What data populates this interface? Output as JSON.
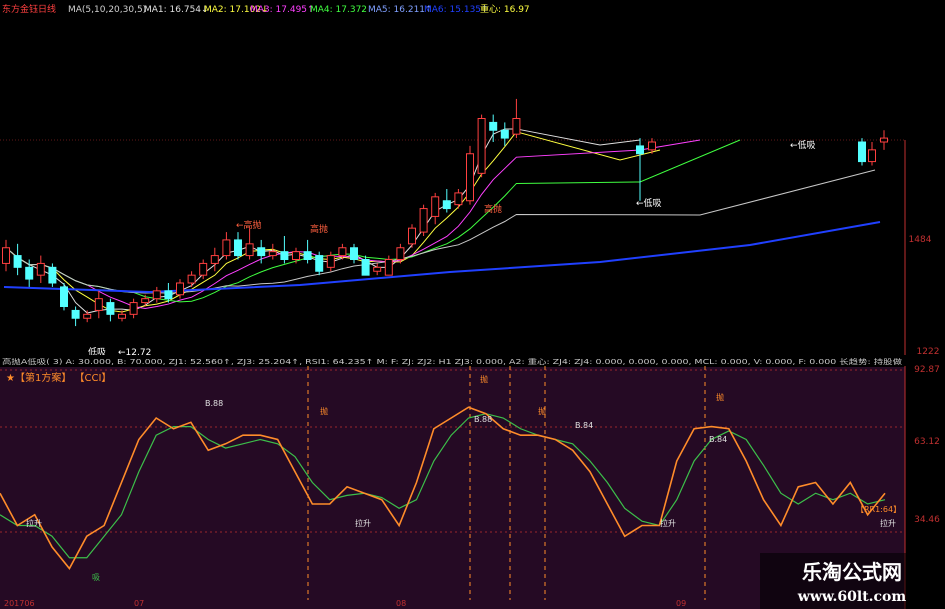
{
  "header": {
    "title": "东方金钰",
    "period": "日线",
    "ma_params": "MA(5,10,20,30,5)",
    "ma1": "MA1: 16.754↓",
    "ma2": "MA2: 17.102↓",
    "ma3": "MA3: 17.495↑",
    "ma4": "MA4: 17.372",
    "ma5": "MA5: 16.211↑",
    "ma6": "MA6: 15.135↑",
    "center": "重心: 16.97"
  },
  "colors": {
    "up": "#ff4040",
    "down": "#54ffff",
    "ma1": "#e0e0e0",
    "ma2": "#ffff40",
    "ma3": "#ff40ff",
    "ma4": "#40ff40",
    "ma5": "#8080ff",
    "ma6": "#2040ff",
    "axis": "#c03030",
    "k": "#ff8c2a",
    "d": "#3cbf4a"
  },
  "price_panel": {
    "axis_labels": [
      "1484",
      "1222"
    ],
    "labels": {
      "high1": "←高抛",
      "high2": "高抛",
      "high3": "高抛",
      "low1": "低吸",
      "low2": "←低吸",
      "low3": "←低吸",
      "low_value": "←12.72"
    },
    "candles": [
      {
        "o": 14.2,
        "c": 14.6,
        "h": 14.8,
        "l": 14.0
      },
      {
        "o": 14.4,
        "c": 14.1,
        "h": 14.7,
        "l": 13.9
      },
      {
        "o": 14.1,
        "c": 13.8,
        "h": 14.3,
        "l": 13.6
      },
      {
        "o": 13.9,
        "c": 14.2,
        "h": 14.4,
        "l": 13.7
      },
      {
        "o": 14.1,
        "c": 13.7,
        "h": 14.2,
        "l": 13.6
      },
      {
        "o": 13.6,
        "c": 13.1,
        "h": 13.7,
        "l": 13.0
      },
      {
        "o": 13.0,
        "c": 12.8,
        "h": 13.1,
        "l": 12.6
      },
      {
        "o": 12.8,
        "c": 12.9,
        "h": 13.0,
        "l": 12.7
      },
      {
        "o": 13.0,
        "c": 13.3,
        "h": 13.5,
        "l": 12.8
      },
      {
        "o": 13.2,
        "c": 12.9,
        "h": 13.3,
        "l": 12.72
      },
      {
        "o": 12.8,
        "c": 12.9,
        "h": 13.0,
        "l": 12.72
      },
      {
        "o": 12.9,
        "c": 13.2,
        "h": 13.3,
        "l": 12.8
      },
      {
        "o": 13.2,
        "c": 13.3,
        "h": 13.4,
        "l": 13.1
      },
      {
        "o": 13.3,
        "c": 13.5,
        "h": 13.6,
        "l": 13.2
      },
      {
        "o": 13.5,
        "c": 13.3,
        "h": 13.7,
        "l": 13.2
      },
      {
        "o": 13.4,
        "c": 13.7,
        "h": 13.8,
        "l": 13.3
      },
      {
        "o": 13.7,
        "c": 13.9,
        "h": 14.0,
        "l": 13.6
      },
      {
        "o": 13.9,
        "c": 14.2,
        "h": 14.3,
        "l": 13.8
      },
      {
        "o": 14.2,
        "c": 14.4,
        "h": 14.6,
        "l": 14.0
      },
      {
        "o": 14.4,
        "c": 14.8,
        "h": 15.0,
        "l": 14.3
      },
      {
        "o": 14.8,
        "c": 14.4,
        "h": 15.0,
        "l": 14.3
      },
      {
        "o": 14.4,
        "c": 14.7,
        "h": 15.1,
        "l": 14.3
      },
      {
        "o": 14.6,
        "c": 14.4,
        "h": 14.8,
        "l": 14.2
      },
      {
        "o": 14.4,
        "c": 14.5,
        "h": 14.7,
        "l": 14.3
      },
      {
        "o": 14.5,
        "c": 14.3,
        "h": 14.9,
        "l": 14.2
      },
      {
        "o": 14.3,
        "c": 14.5,
        "h": 14.6,
        "l": 14.2
      },
      {
        "o": 14.5,
        "c": 14.3,
        "h": 14.8,
        "l": 14.2
      },
      {
        "o": 14.4,
        "c": 14.0,
        "h": 14.5,
        "l": 13.9
      },
      {
        "o": 14.1,
        "c": 14.4,
        "h": 14.5,
        "l": 14.0
      },
      {
        "o": 14.4,
        "c": 14.6,
        "h": 14.7,
        "l": 14.3
      },
      {
        "o": 14.6,
        "c": 14.3,
        "h": 14.7,
        "l": 14.2
      },
      {
        "o": 14.3,
        "c": 13.9,
        "h": 14.4,
        "l": 13.9
      },
      {
        "o": 14.0,
        "c": 14.1,
        "h": 14.2,
        "l": 13.9
      },
      {
        "o": 13.9,
        "c": 14.3,
        "h": 14.4,
        "l": 13.9
      },
      {
        "o": 14.3,
        "c": 14.6,
        "h": 14.7,
        "l": 14.2
      },
      {
        "o": 14.7,
        "c": 15.1,
        "h": 15.2,
        "l": 14.6
      },
      {
        "o": 15.0,
        "c": 15.6,
        "h": 15.7,
        "l": 14.9
      },
      {
        "o": 15.4,
        "c": 15.9,
        "h": 16.0,
        "l": 15.2
      },
      {
        "o": 15.8,
        "c": 15.6,
        "h": 16.1,
        "l": 15.5
      },
      {
        "o": 15.7,
        "c": 16.0,
        "h": 16.1,
        "l": 15.6
      },
      {
        "o": 15.8,
        "c": 17.0,
        "h": 17.2,
        "l": 15.7
      },
      {
        "o": 16.5,
        "c": 17.9,
        "h": 18.0,
        "l": 16.4
      },
      {
        "o": 17.8,
        "c": 17.6,
        "h": 18.0,
        "l": 17.3
      },
      {
        "o": 17.6,
        "c": 17.4,
        "h": 17.8,
        "l": 17.2
      },
      {
        "o": 17.5,
        "c": 17.9,
        "h": 18.4,
        "l": 17.4
      }
    ],
    "right_candles": [
      {
        "o": 17.2,
        "c": 17.0,
        "h": 17.4,
        "l": 15.8
      },
      {
        "o": 17.1,
        "c": 17.3,
        "h": 17.4,
        "l": 17.0
      },
      {
        "o": 17.3,
        "c": 16.8,
        "h": 17.4,
        "l": 16.7
      },
      {
        "o": 16.8,
        "c": 17.1,
        "h": 17.3,
        "l": 16.7
      },
      {
        "o": 17.3,
        "c": 17.4,
        "h": 17.6,
        "l": 17.1
      }
    ]
  },
  "indicator_panel": {
    "params": "高抛A低吸( 3)  A: 30.000, B: 70.000, ZJ1: 52.560↑, ZJ3: 25.204↑, RSI1: 64.235↑  M: F:  ZJ: ZJ2: H1  ZJ3: 0.000, A2: 重心: ZJ4: ZJ4: 0.000, 0.000, 0.000, MCL: 0.000, V: 0.000, F: 0.000  长趋势: 持股做",
    "subtitle": "★【第1方案】   【CCI】",
    "axis_labels": [
      "92.87",
      "63.12",
      "34.46"
    ],
    "annotations": {
      "b88a": "B.88",
      "b88b": "B.88",
      "b84a": "B.84",
      "b84b": "B.84",
      "throw": "抛",
      "pull": "拉升",
      "rr": "【RR1:64】",
      "buy": "吸"
    },
    "k_values": [
      45,
      30,
      35,
      20,
      10,
      25,
      30,
      50,
      70,
      80,
      75,
      78,
      65,
      68,
      72,
      72,
      70,
      55,
      40,
      40,
      48,
      45,
      42,
      30,
      50,
      75,
      80,
      85,
      82,
      75,
      72,
      72,
      70,
      65,
      55,
      40,
      25,
      30,
      30,
      60,
      75,
      76,
      75,
      60,
      42,
      30,
      48,
      50,
      40,
      50,
      35,
      45
    ],
    "d_values": [
      35,
      30,
      30,
      25,
      15,
      15,
      25,
      35,
      55,
      72,
      76,
      76,
      70,
      66,
      68,
      70,
      68,
      62,
      50,
      42,
      44,
      45,
      43,
      38,
      42,
      60,
      72,
      80,
      82,
      80,
      75,
      72,
      70,
      68,
      60,
      50,
      38,
      32,
      30,
      42,
      60,
      70,
      74,
      70,
      58,
      45,
      40,
      45,
      42,
      45,
      40,
      42
    ],
    "dates": [
      "201706",
      "07",
      "08",
      "09"
    ]
  },
  "watermark": {
    "site_cn": "乐淘公式网",
    "site_url": "www.60lt.com"
  }
}
